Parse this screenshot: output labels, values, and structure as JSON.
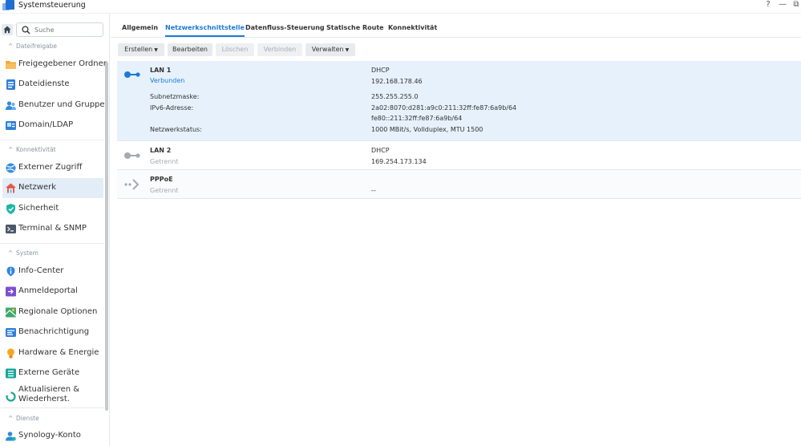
{
  "window": {
    "title": "Systemsteuerung",
    "controls": [
      "?",
      "—",
      "⧉"
    ]
  },
  "sidebar": {
    "search_placeholder": "Suche",
    "sections": [
      {
        "label": "Dateifreigabe",
        "items": [
          "Freigegebener Ordner",
          "Dateidienste",
          "Benutzer und Gruppe",
          "Domain/LDAP"
        ]
      },
      {
        "label": "Konnektivität",
        "items": [
          "Externer Zugriff",
          "Netzwerk",
          "Sicherheit",
          "Terminal & SNMP"
        ]
      },
      {
        "label": "System",
        "items": [
          "Info-Center",
          "Anmeldeportal",
          "Regionale Optionen",
          "Benachrichtigung",
          "Hardware & Energie",
          "Externe Geräte",
          "Aktualisieren &",
          "Wiederherst."
        ]
      },
      {
        "label": "Dienste",
        "items": [
          "Synology-Konto"
        ]
      }
    ],
    "active_item": "Netzwerk"
  },
  "tabs": [
    "Allgemein",
    "Netzwerkschnittstelle",
    "Datenfluss-Steuerung",
    "Statische Route",
    "Konnektivität"
  ],
  "active_tab": "Netzwerkschnittstelle",
  "toolbar": {
    "create": "Erstellen",
    "edit": "Bearbeiten",
    "delete": "Löschen",
    "connect": "Verbinden",
    "manage": "Verwalten"
  },
  "interfaces": [
    {
      "name": "LAN 1",
      "status": "Verbunden",
      "mode": "DHCP",
      "ip": "192.168.178.46",
      "subnet_label": "Subnetzmaske:",
      "subnet": "255.255.255.0",
      "ipv6_label": "IPv6-Adresse:",
      "ipv6_1": "2a02:8070:d281:a9c0:211:32ff:fe87:6a9b/64",
      "ipv6_2": "fe80::211:32ff:fe87:6a9b/64",
      "netstatus_label": "Netzwerkstatus:",
      "netstatus": "1000 MBit/s, Vollduplex, MTU 1500"
    },
    {
      "name": "LAN 2",
      "status": "Getrennt",
      "mode": "DHCP",
      "ip": "169.254.173.134"
    },
    {
      "name": "PPPoE",
      "status": "Getrennt",
      "ip": "--"
    }
  ],
  "colors": {
    "accent": "#1b7bd6",
    "selected_row": "#e6f1fb",
    "disconnected": "#a3aab2"
  }
}
